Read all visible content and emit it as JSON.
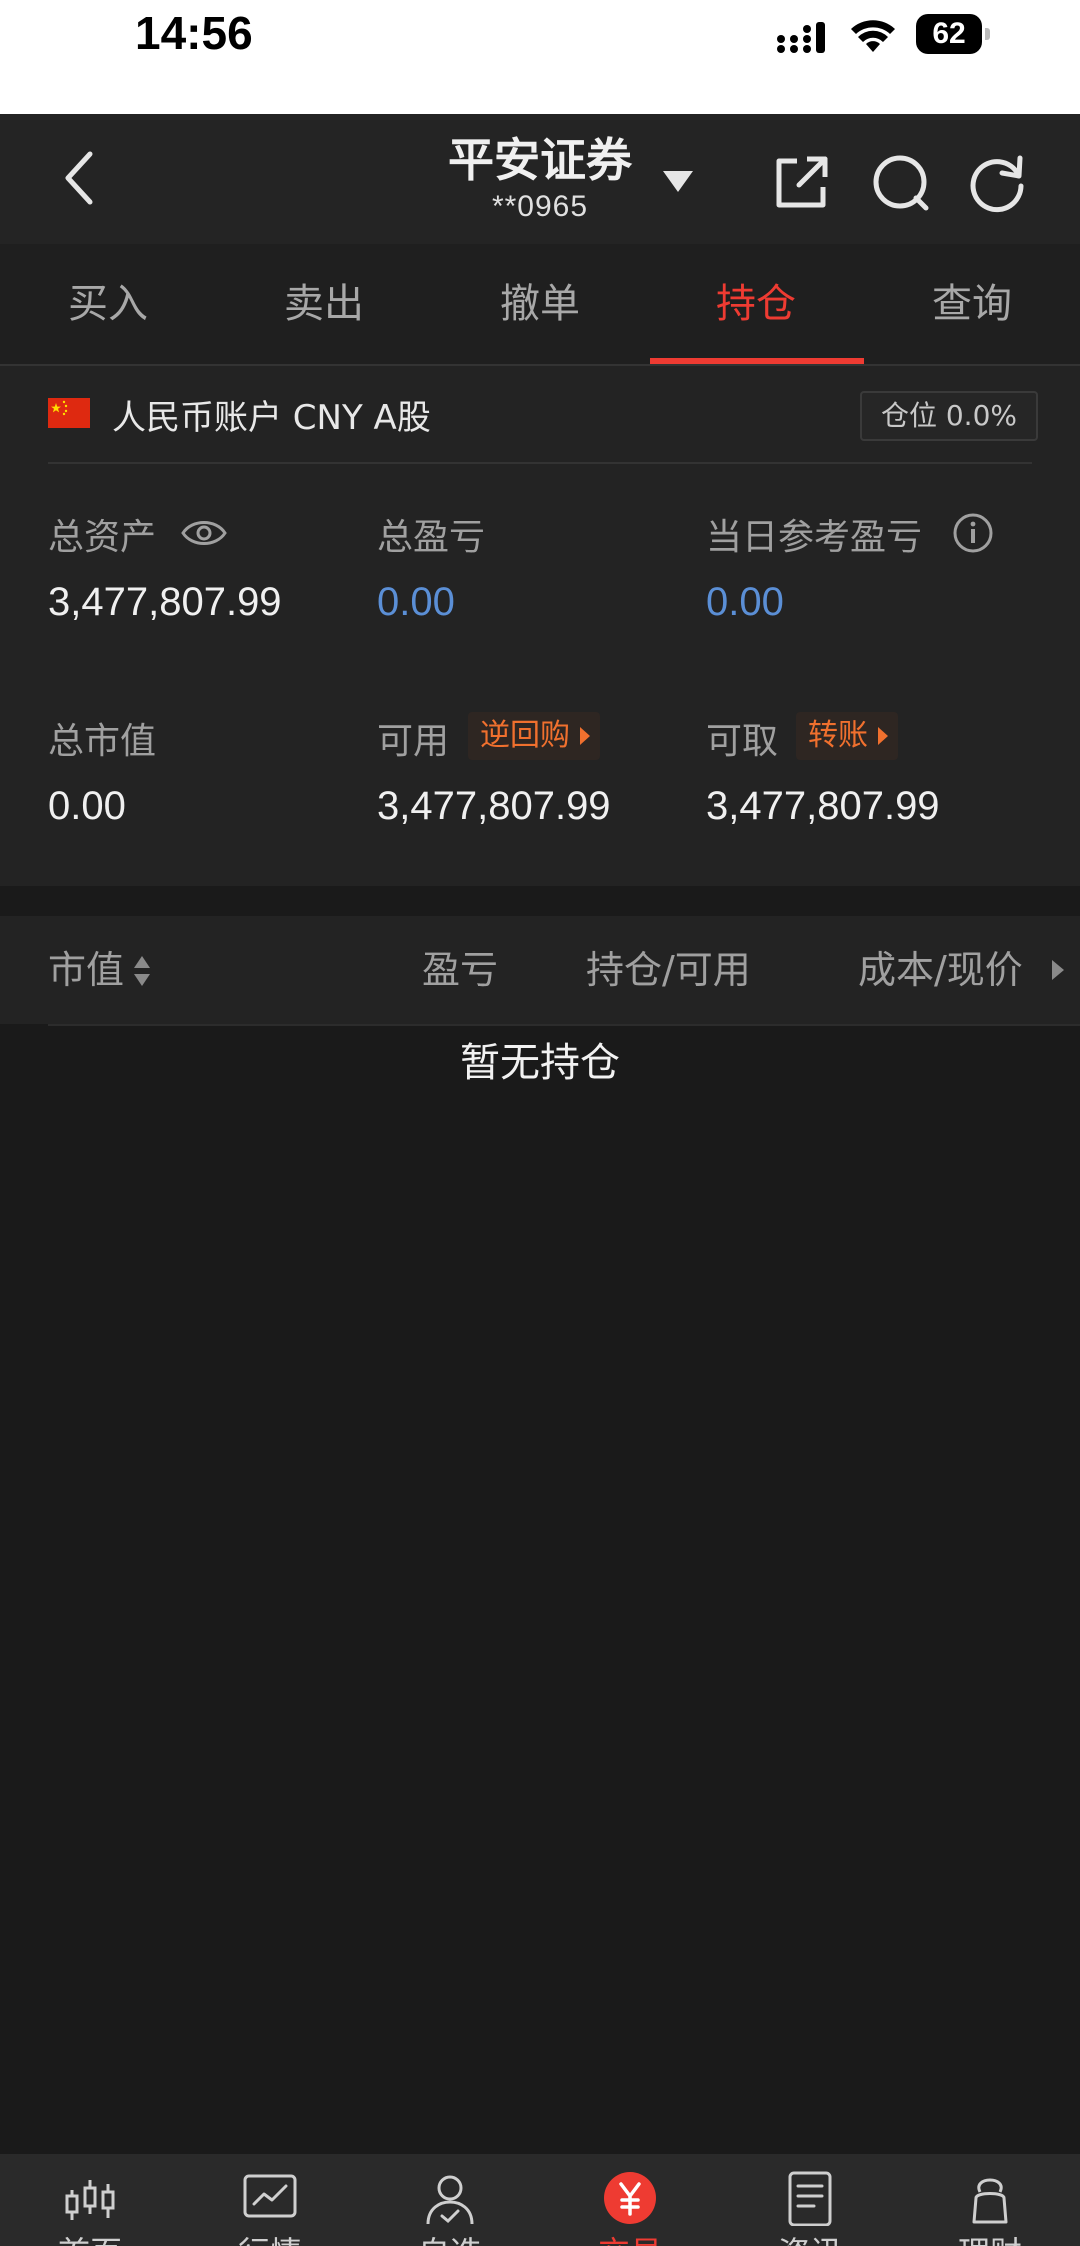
{
  "status_bar": {
    "time": "14:56",
    "battery": "62"
  },
  "header": {
    "title": "平安证券",
    "account_masked": "**0965"
  },
  "tabs": [
    {
      "label": "买入"
    },
    {
      "label": "卖出"
    },
    {
      "label": "撤单"
    },
    {
      "label": "持仓",
      "active": true
    },
    {
      "label": "查询"
    }
  ],
  "account": {
    "label": "人民币账户 CNY A股",
    "position_ratio": "仓位 0.0%"
  },
  "metrics": {
    "total_assets_label": "总资产",
    "total_assets_value": "3,477,807.99",
    "total_pnl_label": "总盈亏",
    "total_pnl_value": "0.00",
    "daily_pnl_label": "当日参考盈亏",
    "daily_pnl_value": "0.00",
    "market_value_label": "总市值",
    "market_value_value": "0.00",
    "available_label": "可用",
    "available_tag": "逆回购",
    "available_value": "3,477,807.99",
    "withdrawable_label": "可取",
    "withdrawable_tag": "转账",
    "withdrawable_value": "3,477,807.99"
  },
  "table": {
    "columns": [
      "市值",
      "盈亏",
      "持仓/可用",
      "成本/现价"
    ],
    "empty_text": "暂无持仓"
  },
  "bottom_nav": [
    {
      "label": "首页",
      "icon": "candlestick-icon"
    },
    {
      "label": "行情",
      "icon": "chart-icon"
    },
    {
      "label": "自选",
      "icon": "user-check-icon"
    },
    {
      "label": "交易",
      "icon": "yuan-icon",
      "active": true
    },
    {
      "label": "资讯",
      "icon": "document-icon"
    },
    {
      "label": "理财",
      "icon": "moneybag-icon"
    }
  ],
  "colors": {
    "accent": "#ee3b32",
    "blue_value": "#5b8fd6",
    "tag_orange": "#f0702e"
  }
}
